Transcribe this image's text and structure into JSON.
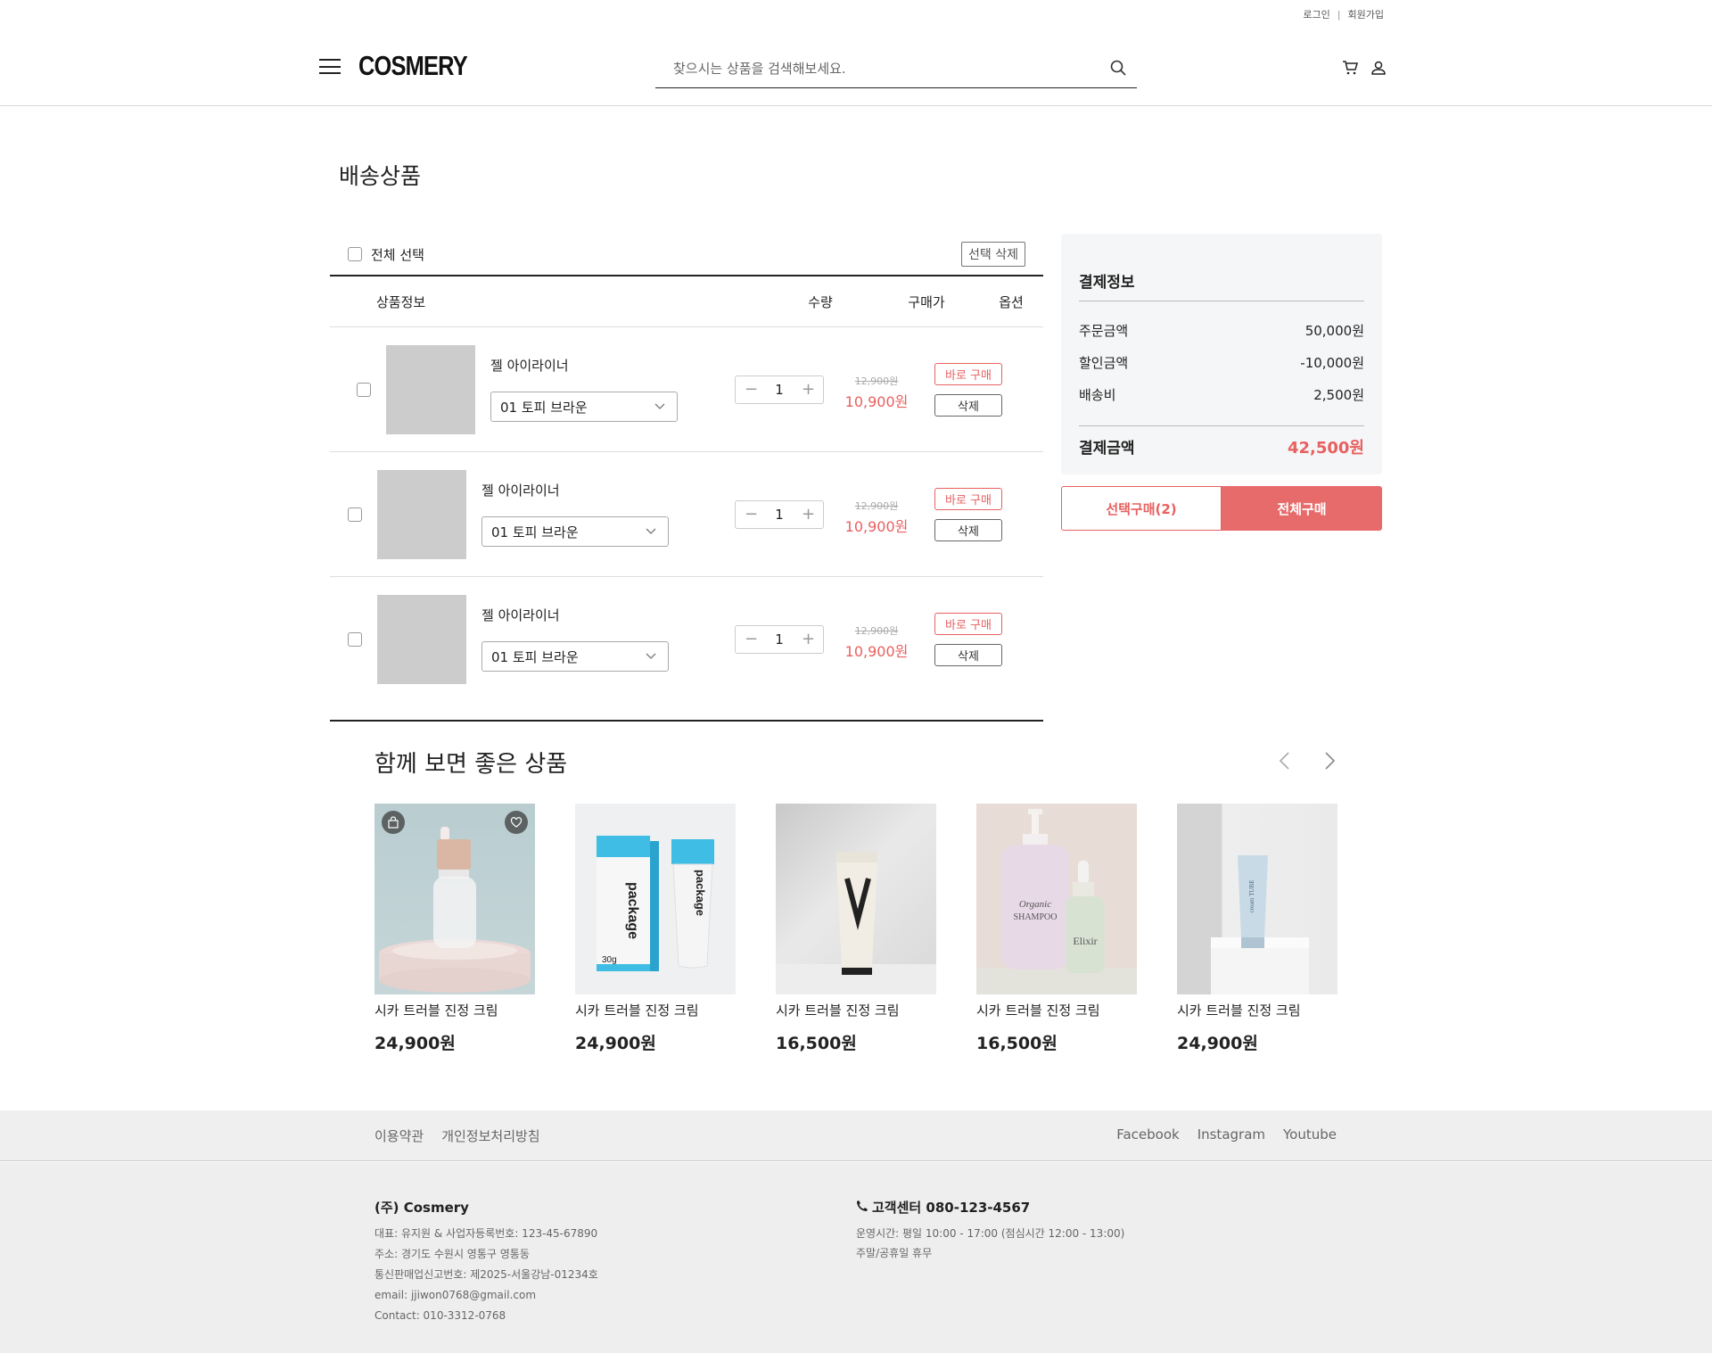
{
  "header": {
    "login": "로그인",
    "signup": "회원가입",
    "logo": "COSMERY",
    "search_placeholder": "찾으시는 상품을 검색해보세요."
  },
  "page_title": "배송상품",
  "cart": {
    "select_all": "전체 선택",
    "delete_selected": "선택 삭제",
    "columns": [
      "상품정보",
      "수량",
      "구매가",
      "옵션"
    ],
    "items": [
      {
        "name": "젤 아이라이너",
        "option": "01 토피 브라운",
        "qty": "1",
        "original_price": "12,900원",
        "sale_price": "10,900원",
        "buy_now": "바로 구매",
        "delete": "삭제"
      },
      {
        "name": "젤 아이라이너",
        "option": "01 토피 브라운",
        "qty": "1",
        "original_price": "12,900원",
        "sale_price": "10,900원",
        "buy_now": "바로 구매",
        "delete": "삭제"
      },
      {
        "name": "젤 아이라이너",
        "option": "01 토피 브라운",
        "qty": "1",
        "original_price": "12,900원",
        "sale_price": "10,900원",
        "buy_now": "바로 구매",
        "delete": "삭제"
      }
    ]
  },
  "summary": {
    "title": "결제정보",
    "order_amount_label": "주문금액",
    "order_amount": "50,000원",
    "discount_label": "할인금액",
    "discount": "-10,000원",
    "shipping_label": "배송비",
    "shipping": "2,500원",
    "total_label": "결제금액",
    "total": "42,500원",
    "buy_selected": "선택구매(2)",
    "buy_all": "전체구매"
  },
  "recommendations": {
    "title": "함께 보면 좋은 상품",
    "items": [
      {
        "name": "시카 트러블 진정 크림",
        "price": "24,900원"
      },
      {
        "name": "시카 트러블 진정 크림",
        "price": "24,900원"
      },
      {
        "name": "시카 트러블 진정 크림",
        "price": "16,500원"
      },
      {
        "name": "시카 트러블 진정 크림",
        "price": "16,500원"
      },
      {
        "name": "시카 트러블 진정 크림",
        "price": "24,900원"
      }
    ],
    "product_labels": {
      "package": "package",
      "package_weight": "30g",
      "shampoo_brand": "Organic",
      "shampoo_name": "SHAMPOO",
      "elixir": "Elixir",
      "tube": "cream TUBE"
    }
  },
  "footer": {
    "terms": "이용약관",
    "privacy": "개인정보처리방침",
    "facebook": "Facebook",
    "instagram": "Instagram",
    "youtube": "Youtube",
    "company_name": "(주) Cosmery",
    "ceo": "대표: 유지원 & 사업자등록번호: 123-45-67890",
    "address": "주소: 경기도 수원시 영통구 영통동",
    "mail_order": "통신판매업신고번호: 제2025-서울강남-01234호",
    "email": "email: jjiwon0768@gmail.com",
    "contact": "Contact: 010-3312-0768",
    "cs_title": "고객센터 080-123-4567",
    "hours": "운영시간: 평일 10:00 - 17:00 (점심시간 12:00 - 13:00)",
    "holiday": "주말/공휴일 휴무"
  },
  "colors": {
    "accent": "#e86b6b",
    "placeholder_gray": "#cccccc",
    "footer_bg": "#eeeeee",
    "summary_bg": "#f5f6f7"
  },
  "icons": [
    "hamburger-icon",
    "search-icon",
    "cart-icon",
    "user-icon",
    "chevron-down-icon",
    "minus-icon",
    "plus-icon",
    "chevron-left-icon",
    "chevron-right-icon",
    "shopping-bag-icon",
    "heart-icon",
    "phone-icon"
  ]
}
